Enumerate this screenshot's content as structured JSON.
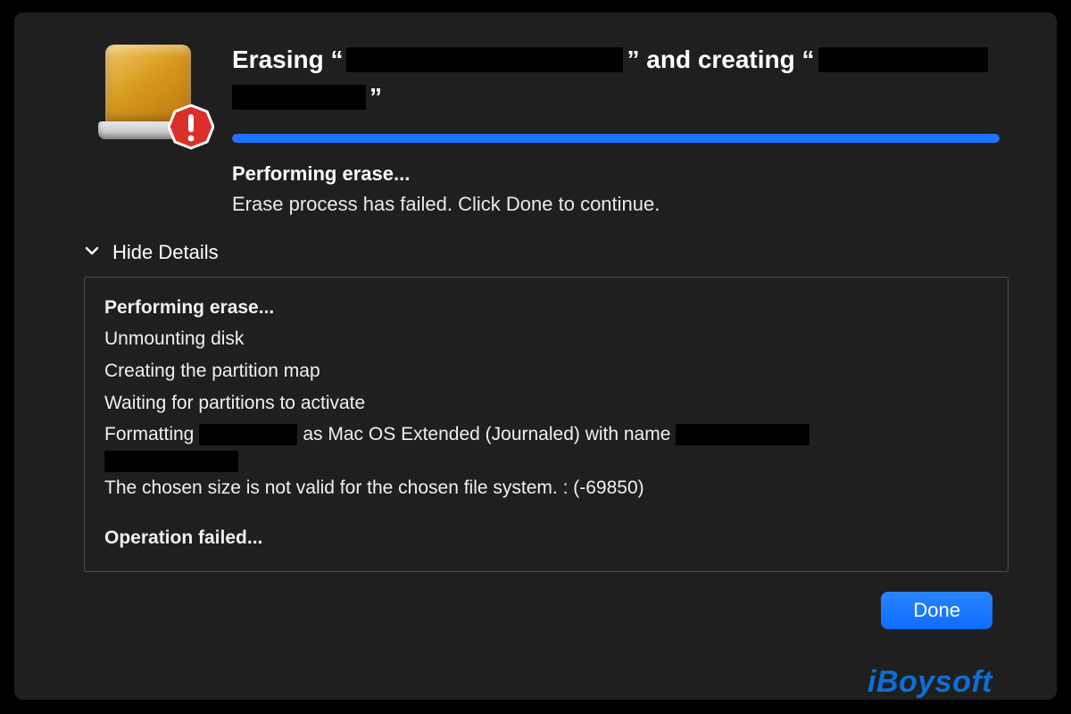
{
  "header": {
    "title_prefix": "Erasing “",
    "title_mid": "” and creating “",
    "title_suffix_close": "”"
  },
  "progress": {
    "percent": 100
  },
  "status": {
    "heading": "Performing erase...",
    "message": "Erase process has failed. Click Done to continue."
  },
  "details_toggle_label": "Hide Details",
  "log": {
    "l0": "Performing erase...",
    "l1": "Unmounting disk",
    "l2": "Creating the partition map",
    "l3": "Waiting for partitions to activate",
    "l4_a": "Formatting",
    "l4_b": "as Mac OS Extended (Journaled) with name",
    "l5": "The chosen size is not valid for the chosen file system. : (-69850)",
    "l6": "Operation failed..."
  },
  "buttons": {
    "done": "Done"
  },
  "watermark": "iBoysoft"
}
